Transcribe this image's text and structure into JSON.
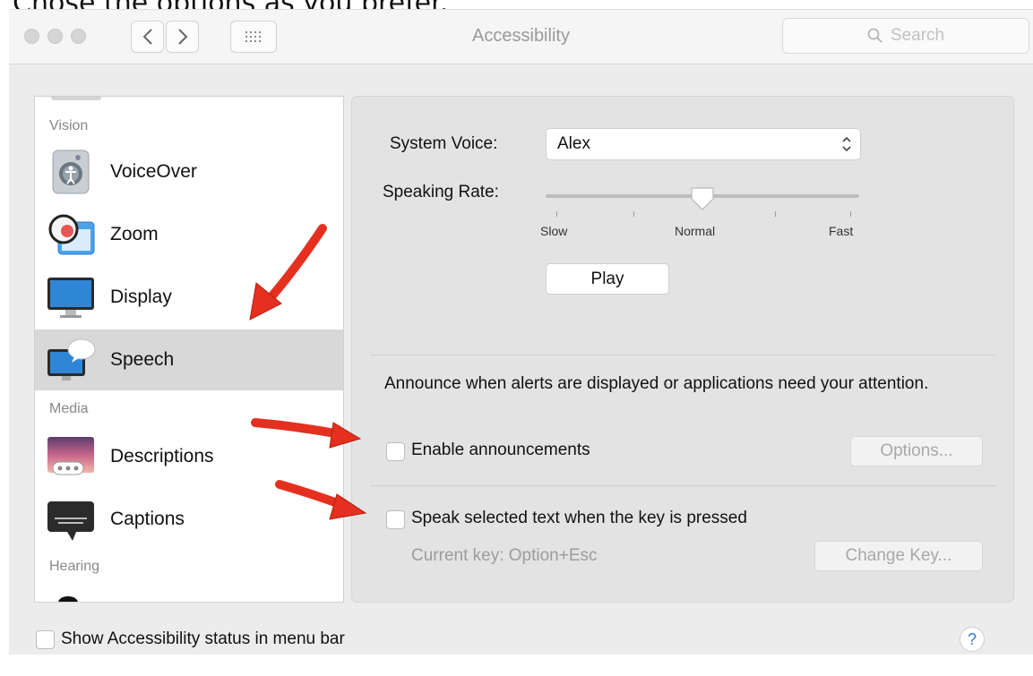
{
  "caption": "Chose the options as you prefer.",
  "window": {
    "title": "Accessibility"
  },
  "search": {
    "placeholder": "Search",
    "icon": "magnifier-icon"
  },
  "sidebar": {
    "sections": {
      "vision": "Vision",
      "media": "Media",
      "hearing": "Hearing"
    },
    "items": [
      {
        "label": "VoiceOver",
        "icon": "voiceover-icon"
      },
      {
        "label": "Zoom",
        "icon": "zoom-icon"
      },
      {
        "label": "Display",
        "icon": "display-icon"
      },
      {
        "label": "Speech",
        "icon": "speech-icon",
        "selected": true
      },
      {
        "label": "Descriptions",
        "icon": "descriptions-icon"
      },
      {
        "label": "Captions",
        "icon": "captions-icon"
      }
    ]
  },
  "speech": {
    "system_voice_label": "System Voice:",
    "system_voice_value": "Alex",
    "speaking_rate_label": "Speaking Rate:",
    "rate_ticks": {
      "slow": "Slow",
      "normal": "Normal",
      "fast": "Fast"
    },
    "rate_value": 0.5,
    "play_label": "Play",
    "announce_text": "Announce when alerts are displayed or applications need your attention.",
    "enable_announcements_label": "Enable announcements",
    "enable_announcements_checked": false,
    "options_label": "Options...",
    "speak_selected_label": "Speak selected text when the key is pressed",
    "speak_selected_checked": false,
    "current_key_label": "Current key: Option+Esc",
    "change_key_label": "Change Key..."
  },
  "footer": {
    "menu_bar_status_label": "Show Accessibility status in menu bar",
    "menu_bar_status_checked": false,
    "help_label": "?"
  },
  "colors": {
    "annotation_arrow": "#e5301f",
    "help_accent": "#2f7bd8",
    "selected_row": "#d8d8d8"
  }
}
